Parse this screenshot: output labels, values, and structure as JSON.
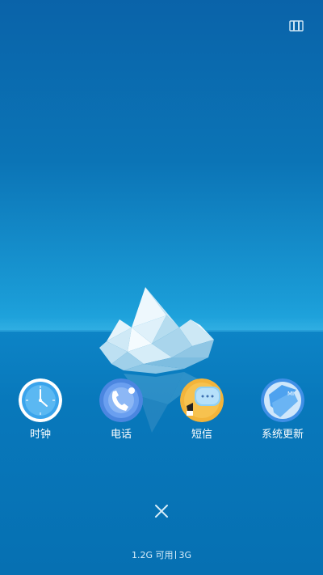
{
  "recents": {
    "apps": [
      {
        "label": "时钟",
        "icon": "clock-icon"
      },
      {
        "label": "电话",
        "icon": "phone-icon"
      },
      {
        "label": "短信",
        "icon": "messages-icon"
      },
      {
        "label": "系统更新",
        "icon": "system-update-icon"
      }
    ],
    "clear_icon": "close-icon",
    "menu_icon": "recent-list-icon"
  },
  "memory": {
    "available": "1.2G 可用",
    "total": "3G"
  },
  "colors": {
    "sky_top": "#0a63a9",
    "sky_bottom": "#21a6de",
    "sea": "#0878bb",
    "text": "#ffffff"
  }
}
